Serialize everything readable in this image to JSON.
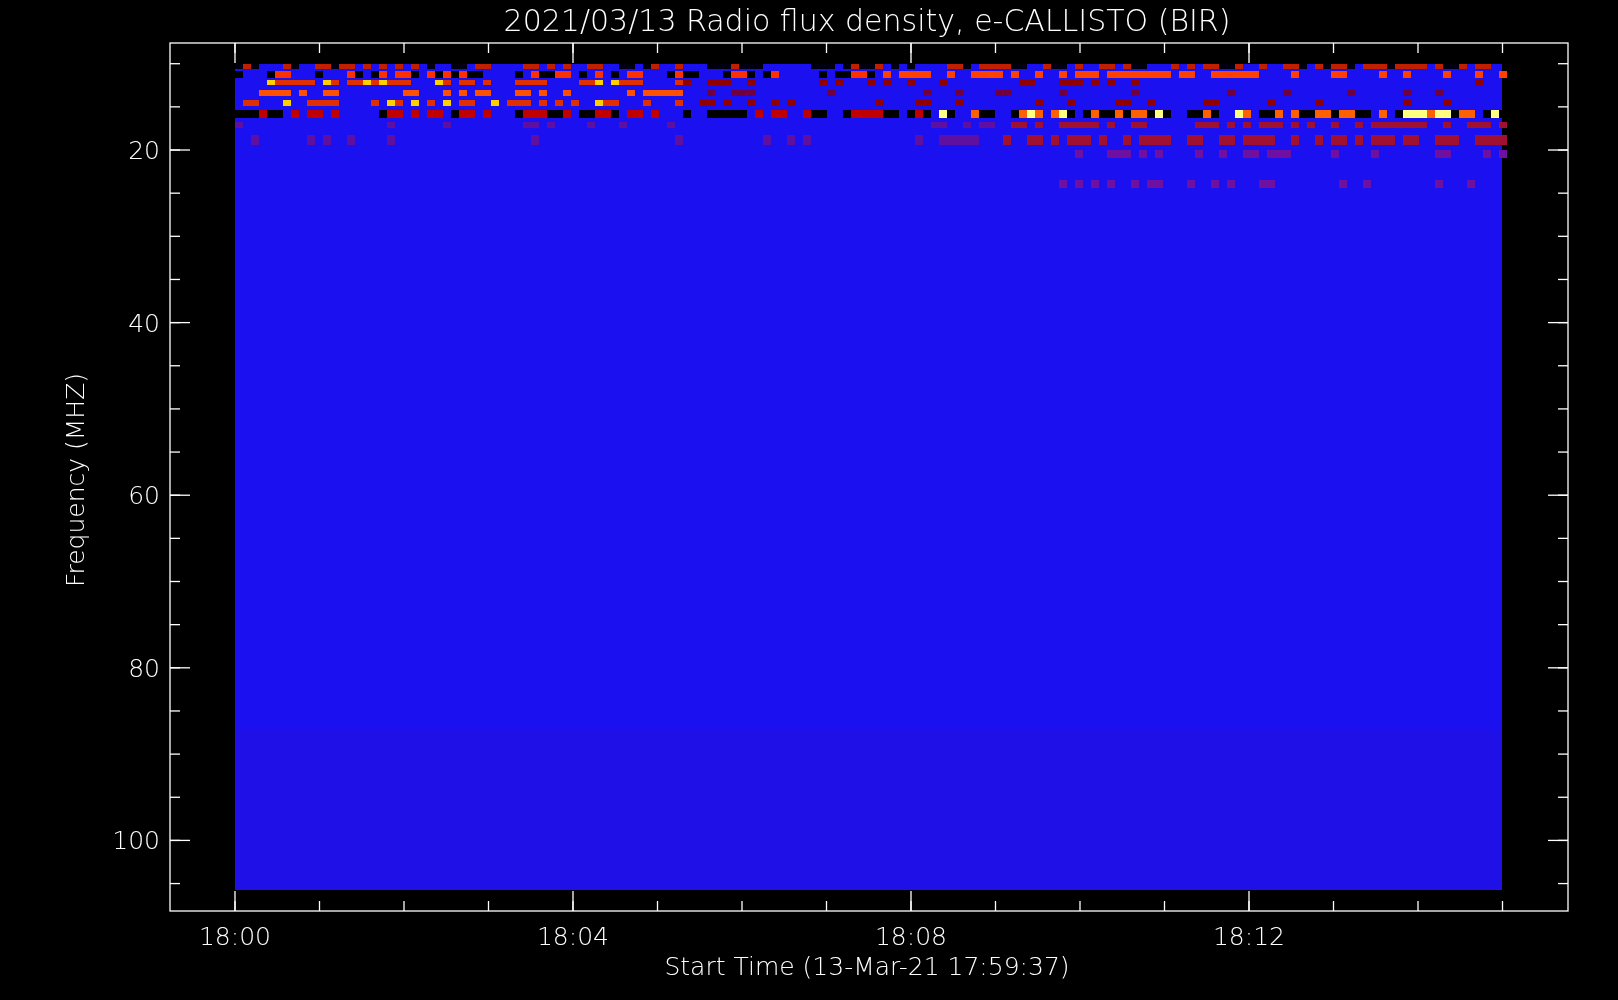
{
  "title": "2021/03/13  Radio flux density, e-CALLISTO (BIR)",
  "y_axis": {
    "label": "Frequency (MHZ)",
    "tick_labels": [
      "20",
      "40",
      "60",
      "80",
      "100"
    ]
  },
  "x_axis": {
    "label": "Start Time (13-Mar-21 17:59:37)",
    "tick_labels": [
      "18:00",
      "18:04",
      "18:08",
      "18:12"
    ]
  }
}
